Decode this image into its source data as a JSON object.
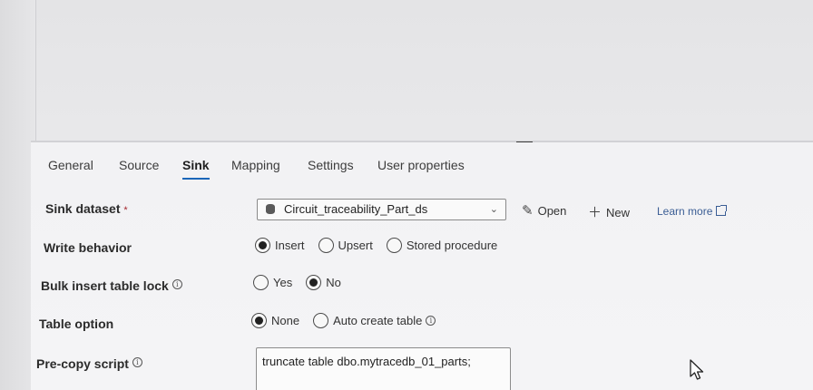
{
  "tabs": [
    {
      "label": "General",
      "active": false
    },
    {
      "label": "Source",
      "active": false
    },
    {
      "label": "Sink",
      "active": true
    },
    {
      "label": "Mapping",
      "active": false
    },
    {
      "label": "Settings",
      "active": false
    },
    {
      "label": "User properties",
      "active": false
    }
  ],
  "sink_dataset": {
    "label": "Sink dataset",
    "required_marker": "*",
    "selected_value": "Circuit_traceability_Part_ds",
    "icon": "database-icon",
    "open_label": "Open",
    "new_label": "New",
    "learn_more_label": "Learn more"
  },
  "write_behavior": {
    "label": "Write behavior",
    "options": [
      "Insert",
      "Upsert",
      "Stored procedure"
    ],
    "selected": "Insert"
  },
  "bulk_insert_lock": {
    "label": "Bulk insert table lock",
    "options": [
      "Yes",
      "No"
    ],
    "selected": "No"
  },
  "table_option": {
    "label": "Table option",
    "options": [
      "None",
      "Auto create table"
    ],
    "selected": "None"
  },
  "pre_copy_script": {
    "label": "Pre-copy script",
    "value": "truncate table dbo.mytracedb_01_parts;"
  },
  "colors": {
    "accent": "#1a66b8",
    "link": "#3a5d94",
    "required": "#a4262c"
  }
}
